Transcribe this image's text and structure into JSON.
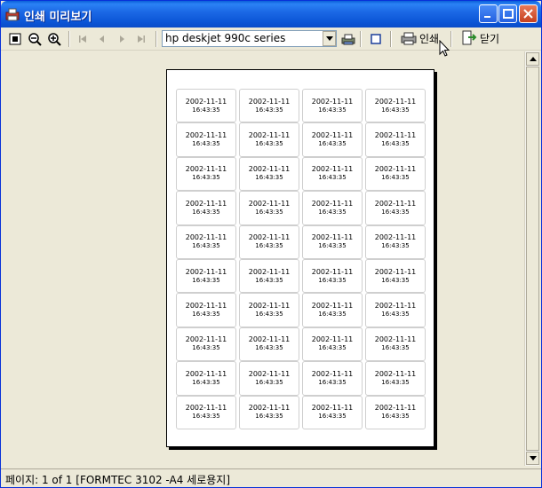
{
  "window": {
    "title": "인쇄 미리보기"
  },
  "toolbar": {
    "printer": "hp deskjet 990c series",
    "print_label": "인쇄",
    "close_label": "닫기"
  },
  "labels": [
    {
      "date": "2002-11-11",
      "time": "16:43:35"
    },
    {
      "date": "2002-11-11",
      "time": "16:43:35"
    },
    {
      "date": "2002-11-11",
      "time": "16:43:35"
    },
    {
      "date": "2002-11-11",
      "time": "16:43:35"
    },
    {
      "date": "2002-11-11",
      "time": "16:43:35"
    },
    {
      "date": "2002-11-11",
      "time": "16:43:35"
    },
    {
      "date": "2002-11-11",
      "time": "16:43:35"
    },
    {
      "date": "2002-11-11",
      "time": "16:43:35"
    },
    {
      "date": "2002-11-11",
      "time": "16:43:35"
    },
    {
      "date": "2002-11-11",
      "time": "16:43:35"
    },
    {
      "date": "2002-11-11",
      "time": "16:43:35"
    },
    {
      "date": "2002-11-11",
      "time": "16:43:35"
    },
    {
      "date": "2002-11-11",
      "time": "16:43:35"
    },
    {
      "date": "2002-11-11",
      "time": "16:43:35"
    },
    {
      "date": "2002-11-11",
      "time": "16:43:35"
    },
    {
      "date": "2002-11-11",
      "time": "16:43:35"
    },
    {
      "date": "2002-11-11",
      "time": "16:43:35"
    },
    {
      "date": "2002-11-11",
      "time": "16:43:35"
    },
    {
      "date": "2002-11-11",
      "time": "16:43:35"
    },
    {
      "date": "2002-11-11",
      "time": "16:43:35"
    },
    {
      "date": "2002-11-11",
      "time": "16:43:35"
    },
    {
      "date": "2002-11-11",
      "time": "16:43:35"
    },
    {
      "date": "2002-11-11",
      "time": "16:43:35"
    },
    {
      "date": "2002-11-11",
      "time": "16:43:35"
    },
    {
      "date": "2002-11-11",
      "time": "16:43:35"
    },
    {
      "date": "2002-11-11",
      "time": "16:43:35"
    },
    {
      "date": "2002-11-11",
      "time": "16:43:35"
    },
    {
      "date": "2002-11-11",
      "time": "16:43:35"
    },
    {
      "date": "2002-11-11",
      "time": "16:43:35"
    },
    {
      "date": "2002-11-11",
      "time": "16:43:35"
    },
    {
      "date": "2002-11-11",
      "time": "16:43:35"
    },
    {
      "date": "2002-11-11",
      "time": "16:43:35"
    },
    {
      "date": "2002-11-11",
      "time": "16:43:35"
    },
    {
      "date": "2002-11-11",
      "time": "16:43:35"
    },
    {
      "date": "2002-11-11",
      "time": "16:43:35"
    },
    {
      "date": "2002-11-11",
      "time": "16:43:35"
    },
    {
      "date": "2002-11-11",
      "time": "16:43:35"
    },
    {
      "date": "2002-11-11",
      "time": "16:43:35"
    },
    {
      "date": "2002-11-11",
      "time": "16:43:35"
    },
    {
      "date": "2002-11-11",
      "time": "16:43:35"
    }
  ],
  "status": {
    "text": "페이지: 1 of 1 [FORMTEC 3102 -A4 세로용지]"
  }
}
